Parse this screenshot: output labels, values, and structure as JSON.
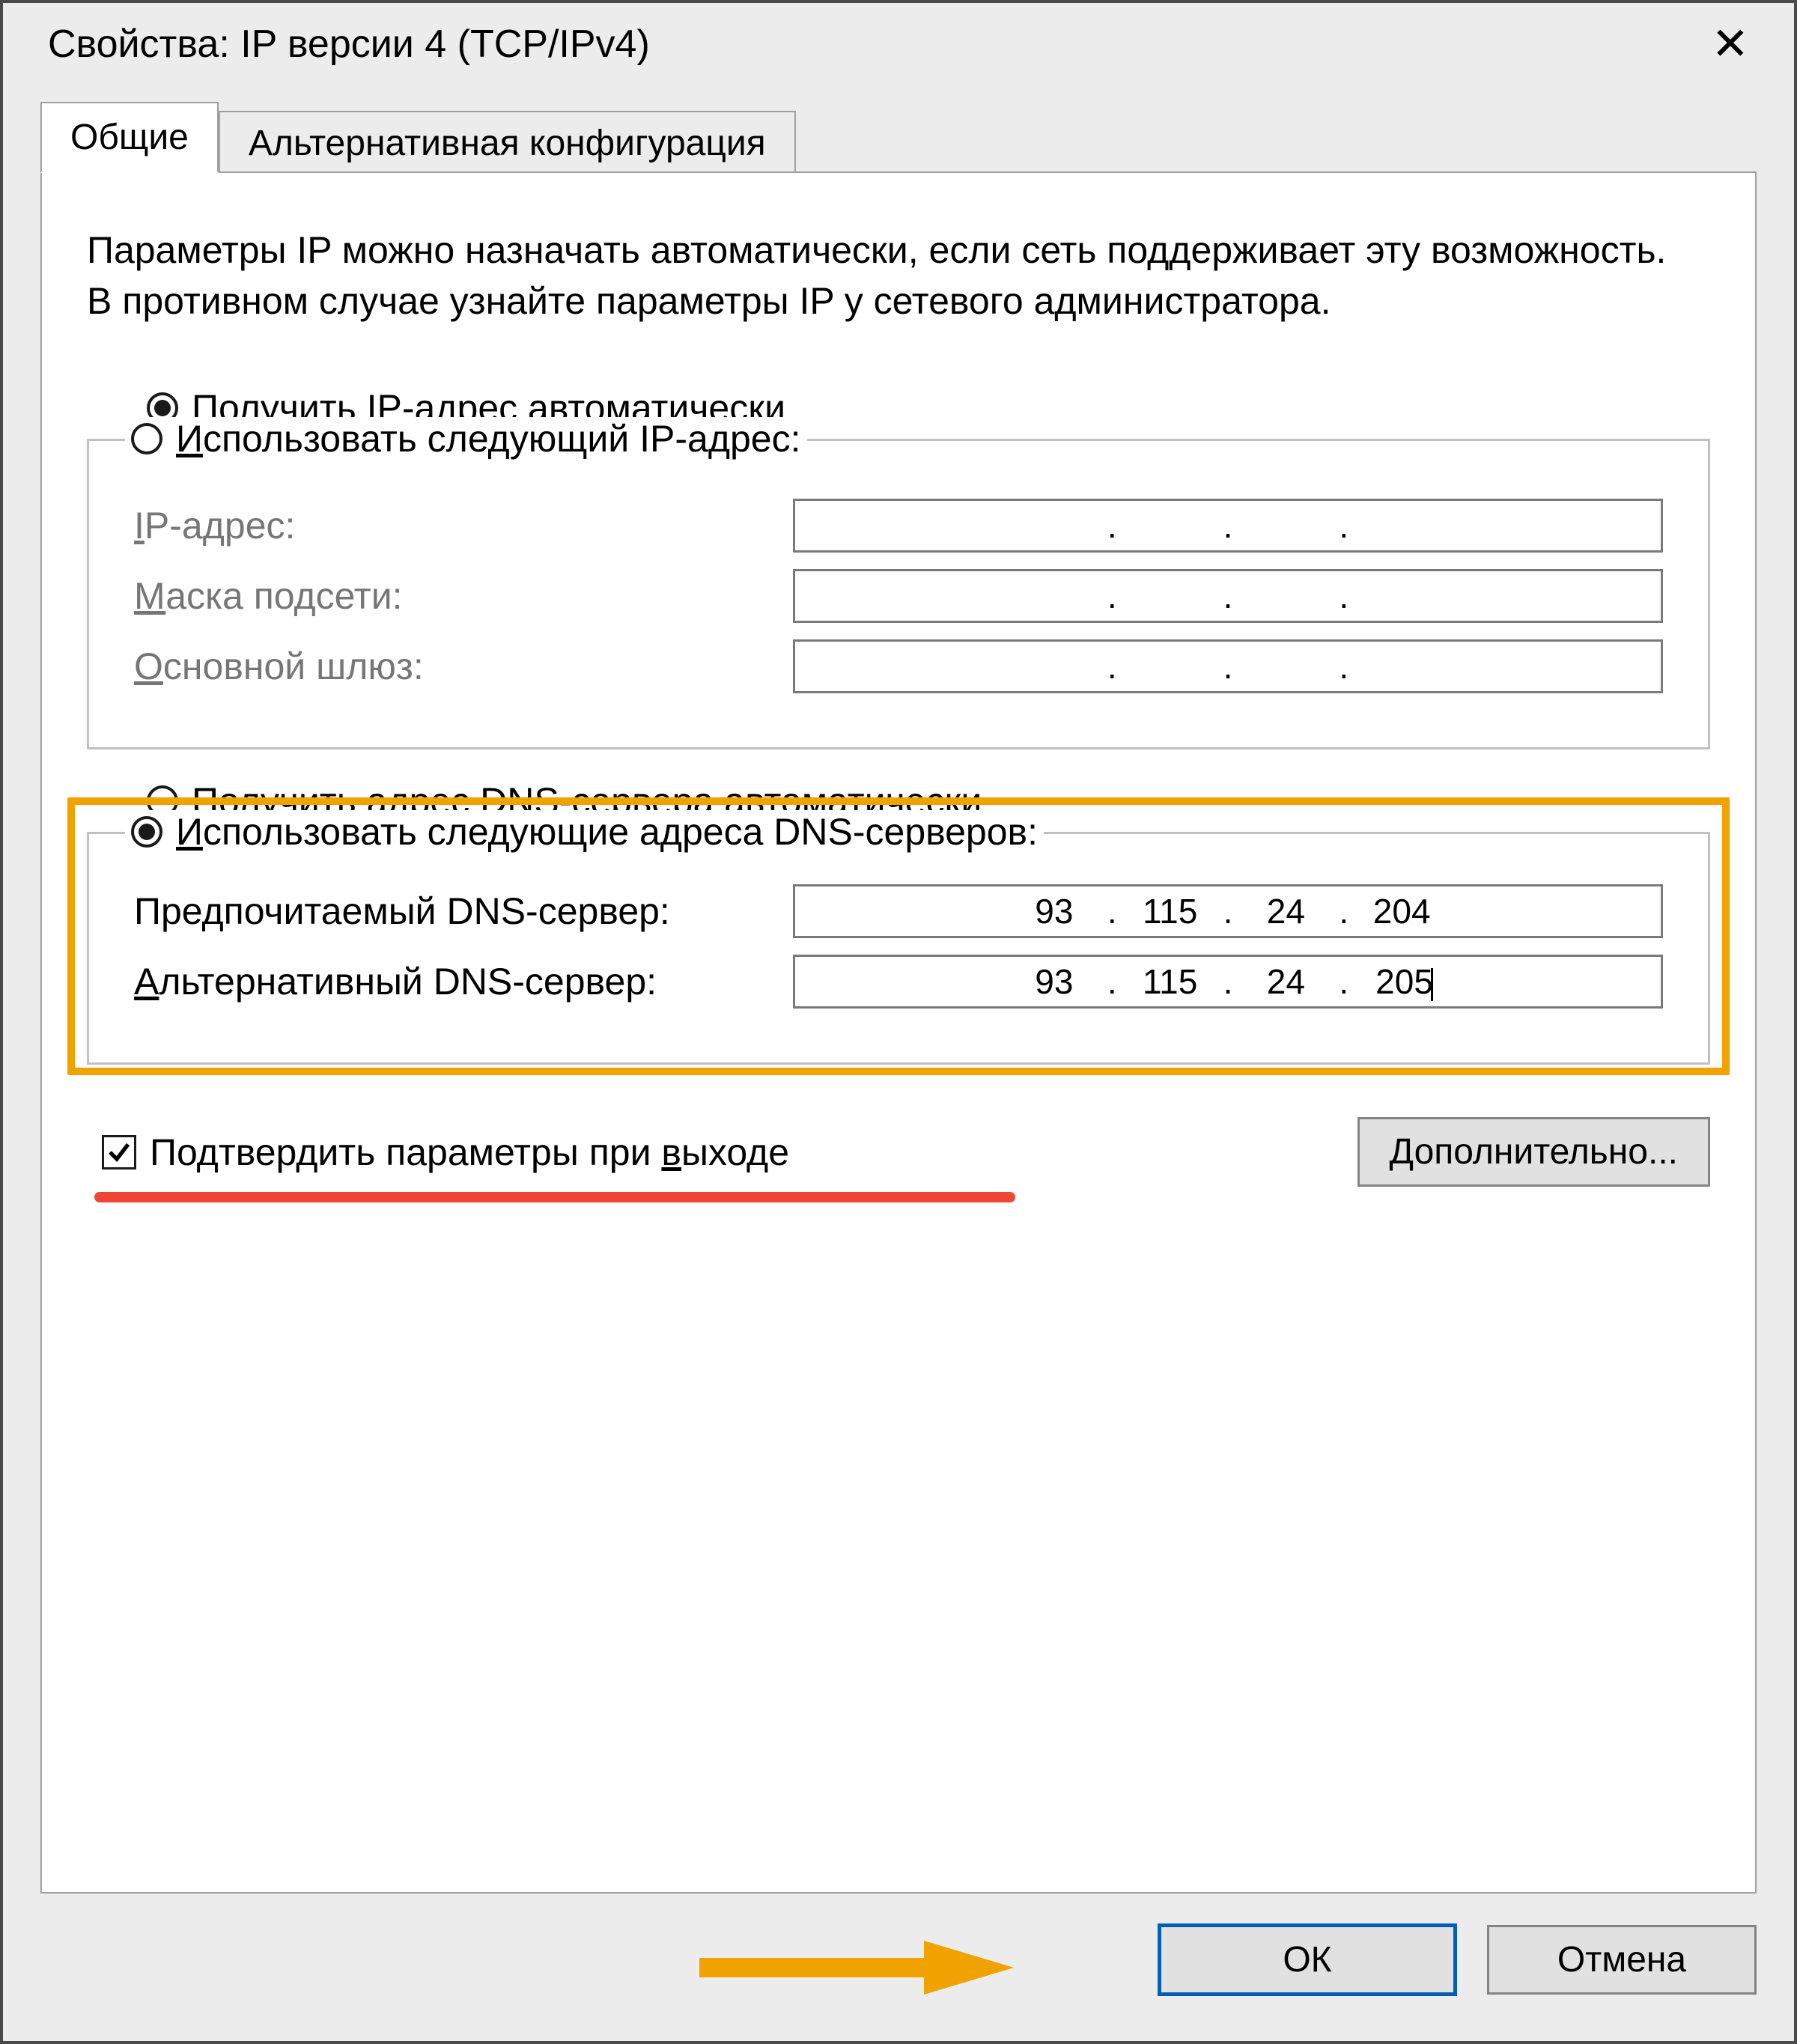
{
  "window": {
    "title": "Свойства: IP версии 4 (TCP/IPv4)"
  },
  "tabs": {
    "general": "Общие",
    "alternate": "Альтернативная конфигурация"
  },
  "intro": "Параметры IP можно назначать автоматически, если сеть поддерживает эту возможность. В противном случае узнайте параметры IP у сетевого администратора.",
  "ip_section": {
    "radio_auto_prefix": "П",
    "radio_auto_rest": "олучить IP-адрес автоматически",
    "radio_manual_prefix": "И",
    "radio_manual_rest": "спользовать следующий IP-адрес:",
    "ip_label_prefix": "I",
    "ip_label_rest": "P-адрес:",
    "mask_label_prefix": "М",
    "mask_label_rest": "аска подсети:",
    "gw_label_prefix": "О",
    "gw_label_rest": "сновной шлюз:"
  },
  "dns_section": {
    "radio_auto_prefix": "П",
    "radio_auto_rest": "олучить адрес DNS-сервера автоматически",
    "radio_manual_prefix": "И",
    "radio_manual_rest": "спользовать следующие адреса DNS-серверов:",
    "pref_label": "Предпочитаемый DNS-сервер:",
    "alt_label_prefix": "А",
    "alt_label_rest": "льтернативный DNS-сервер:",
    "pref_dns": {
      "o1": "93",
      "o2": "115",
      "o3": "24",
      "o4": "204"
    },
    "alt_dns": {
      "o1": "93",
      "o2": "115",
      "o3": "24",
      "o4": "205"
    }
  },
  "validate_before": "Подтвердить параметры при ",
  "validate_acc": "в",
  "validate_after": "ыходе",
  "advanced_label_prefix": "Д",
  "advanced_label_rest": "ополнительно...",
  "ok_label": "ОК",
  "cancel_label": "Отмена"
}
